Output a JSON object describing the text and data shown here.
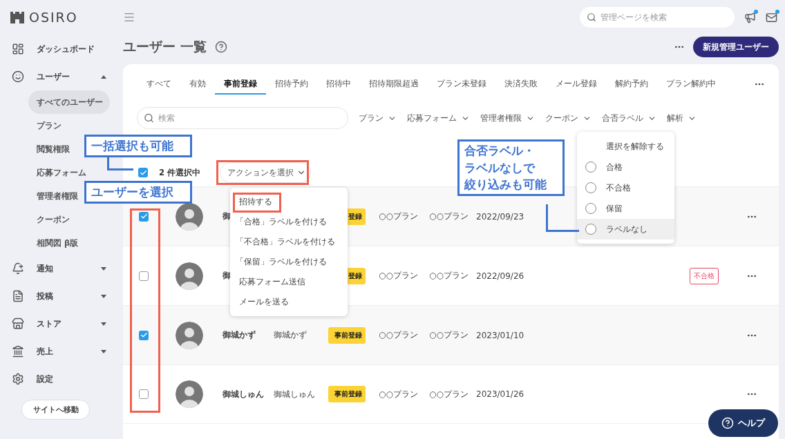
{
  "brand": {
    "name": "OSIRO"
  },
  "top_search": {
    "placeholder": "管理ページを検索"
  },
  "top_icons": [
    {
      "unread": true
    },
    {
      "unread": true
    }
  ],
  "sidebar": {
    "items": [
      {
        "label": "ダッシュボード"
      },
      {
        "label": "ユーザー",
        "expanded": true,
        "children": [
          {
            "label": "すべてのユーザー",
            "selected": true
          },
          {
            "label": "プラン",
            "selected": false
          },
          {
            "label": "閲覧権限",
            "selected": false
          },
          {
            "label": "応募フォーム",
            "selected": false
          },
          {
            "label": "管理者権限",
            "selected": false
          },
          {
            "label": "クーポン",
            "selected": false
          },
          {
            "label": "相関図 β版",
            "selected": false
          }
        ]
      },
      {
        "label": "通知",
        "expanded": false
      },
      {
        "label": "投稿",
        "expanded": false
      },
      {
        "label": "ストア",
        "expanded": false
      },
      {
        "label": "売上",
        "expanded": false
      },
      {
        "label": "設定"
      }
    ],
    "site_button": "サイトへ移動"
  },
  "page": {
    "title": "ユーザー 一覧",
    "new_button": "新規管理ユーザー"
  },
  "tabs": [
    {
      "label": "すべて",
      "selected": false
    },
    {
      "label": "有効",
      "selected": false
    },
    {
      "label": "事前登録",
      "selected": true
    },
    {
      "label": "招待予約",
      "selected": false
    },
    {
      "label": "招待中",
      "selected": false
    },
    {
      "label": "招待期限超過",
      "selected": false
    },
    {
      "label": "プラン未登録",
      "selected": false
    },
    {
      "label": "決済失敗",
      "selected": false
    },
    {
      "label": "メール登録",
      "selected": false
    },
    {
      "label": "解約予約",
      "selected": false
    },
    {
      "label": "プラン解約中",
      "selected": false
    }
  ],
  "list_search": {
    "placeholder": "検索"
  },
  "filters": [
    "プラン",
    "応募フォーム",
    "管理者権限",
    "クーポン",
    "合否ラベル",
    "解析"
  ],
  "selection": {
    "all_checked": true,
    "count": "2 件選択中",
    "action_button": "アクションを選択"
  },
  "action_menu": [
    "招待する",
    "「合格」ラベルを付ける",
    "「不合格」ラベルを付ける",
    "「保留」ラベルを付ける",
    "応募フォーム送信",
    "メールを送る"
  ],
  "label_menu": {
    "clear": "選択を解除する",
    "options": [
      {
        "label": "合格",
        "checked": false,
        "highlighted": false
      },
      {
        "label": "不合格",
        "checked": false,
        "highlighted": false
      },
      {
        "label": "保留",
        "checked": false,
        "highlighted": false
      },
      {
        "label": "ラベルなし",
        "checked": false,
        "highlighted": true
      }
    ]
  },
  "rows": [
    {
      "checked": true,
      "name": "御",
      "badge": "登録",
      "plan": "○○プラン",
      "plan_2": "○○プラン",
      "date": "2022/09/23"
    },
    {
      "checked": false,
      "name": "御",
      "badge": "登録",
      "plan": "○○プラン",
      "plan_2": "○○プラン",
      "date": "2022/09/26",
      "result": "不合格"
    },
    {
      "checked": true,
      "name": "御城かず",
      "name_2": "御城かず",
      "badge": "事前登録",
      "plan": "○○プラン",
      "plan_2": "○○プラン",
      "date": "2023/01/10"
    },
    {
      "checked": false,
      "name": "御城しゅん",
      "name_2": "御城しゅん",
      "badge": "事前登録",
      "plan": "○○プラン",
      "plan_2": "○○プラン",
      "date": "2023/01/26"
    }
  ],
  "annotations": [
    {
      "lines": [
        "一括選択も可能"
      ]
    },
    {
      "lines": [
        "ユーザーを選択"
      ]
    },
    {
      "lines": [
        "合否ラベル・",
        "ラベルなしで",
        "絞り込みも可能"
      ]
    }
  ],
  "help_button": "ヘルプ"
}
